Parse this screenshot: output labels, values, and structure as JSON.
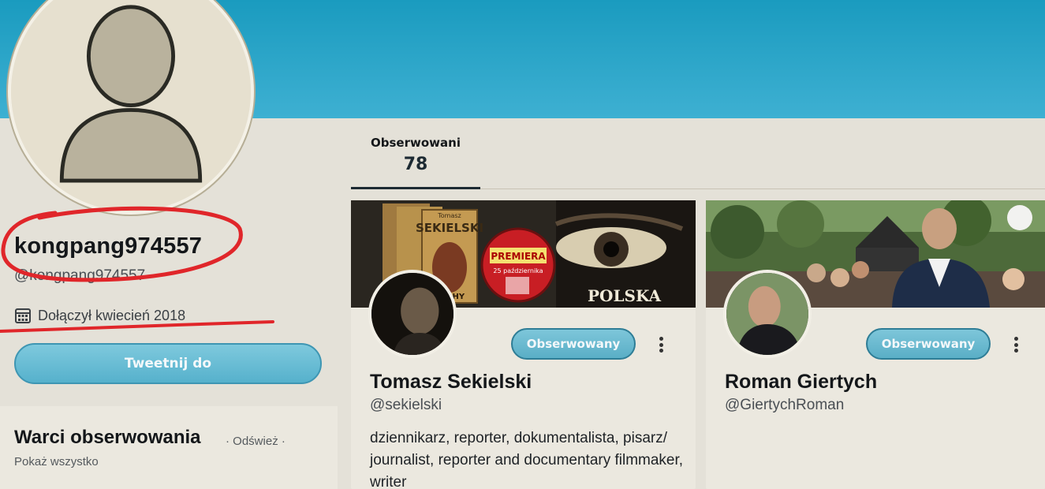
{
  "profile": {
    "display_name": "kongpang974557",
    "handle": "@kongpang974557",
    "joined": "Dołączył kwiecień 2018",
    "tweet_button": "Tweetnij do"
  },
  "tabs": [
    {
      "label": "Obserwowani",
      "count": "78"
    }
  ],
  "who_to_follow": {
    "title": "Warci obserwowania",
    "refresh": "Odśwież",
    "show_all": "Pokaż wszystko",
    "separator": "·"
  },
  "cards": [
    {
      "name": "Tomasz Sekielski",
      "handle": "@sekielski",
      "bio": "dziennikarz, reporter, dokumentalista, pisarz/ journalist, reporter and documentary filmmaker, writer",
      "follow_label": "Obserwowany",
      "banner_texts": {
        "author": "Tomasz",
        "surname": "SEKIELSKI",
        "book_title": "SUCHY",
        "badge_title": "PREMIERA",
        "badge_date": "25 października",
        "brand": "POLSKA"
      }
    },
    {
      "name": "Roman Giertych",
      "handle": "@GiertychRoman",
      "bio": "",
      "follow_label": "Obserwowany"
    }
  ],
  "colors": {
    "banner": "#2aa6c9",
    "accent": "#5ab3cc",
    "annotation": "#e0262a"
  },
  "icons": {
    "calendar": "calendar-icon",
    "more": "more-vertical-icon"
  }
}
